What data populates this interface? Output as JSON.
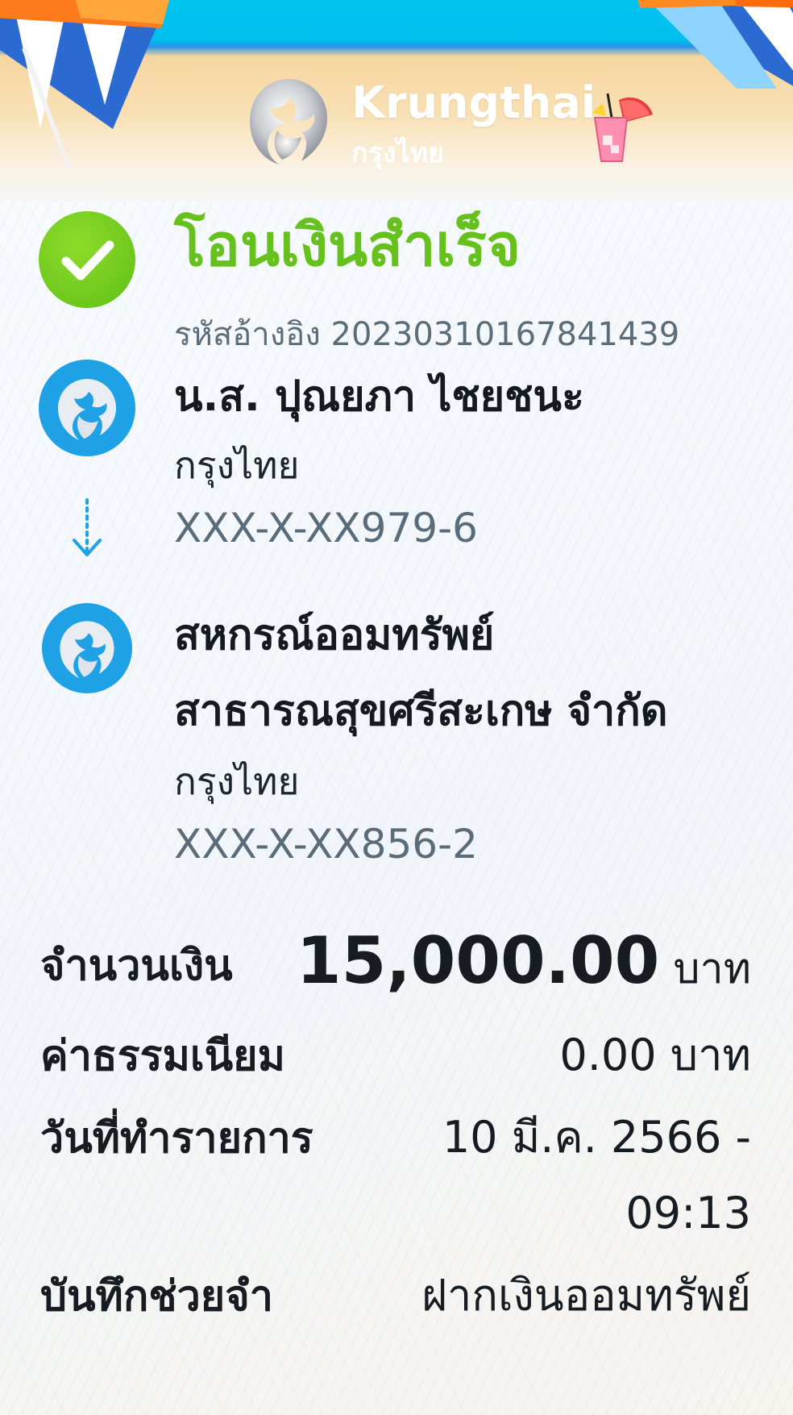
{
  "header": {
    "brand_en": "Krungthai",
    "brand_th": "กรุงไทย"
  },
  "status": {
    "title": "โอนเงินสำเร็จ",
    "ref_label": "รหัสอ้างอิง 2023031016784143 9",
    "color": "#67c11c"
  },
  "sender": {
    "name": "น.ส. ปุณยภา ไชยชนะ",
    "bank": "กรุงไทย",
    "account": "XXX-X-XX979-6"
  },
  "receiver": {
    "name_line1": "สหกรณ์ออมทรัพย์",
    "name_line2": "สาธารณสุขศรีสะเกษ จำกัด",
    "bank": "กรุงไทย",
    "account": "XXX-X-XX856-2"
  },
  "details": {
    "amount_label": "จำนวนเงิน",
    "amount_value": "15,000.00",
    "amount_unit": "บาท",
    "fee_label": "ค่าธรรมเนียม",
    "fee_value": "0.00 บาท",
    "date_label": "วันที่ทำรายการ",
    "date_value_line1": "10 มี.ค. 2566 -",
    "date_value_line2": "09:13",
    "memo_label": "บันทึกช่วยจำ",
    "memo_value": "ฝากเงินออมทรัพย์"
  },
  "icons": {
    "check": "check-circle-icon",
    "bank_logo": "krungthai-logo-icon",
    "arrow": "arrow-down-dotted-icon"
  },
  "colors": {
    "brand_blue": "#1fa1e6",
    "success_green": "#67c11c"
  }
}
